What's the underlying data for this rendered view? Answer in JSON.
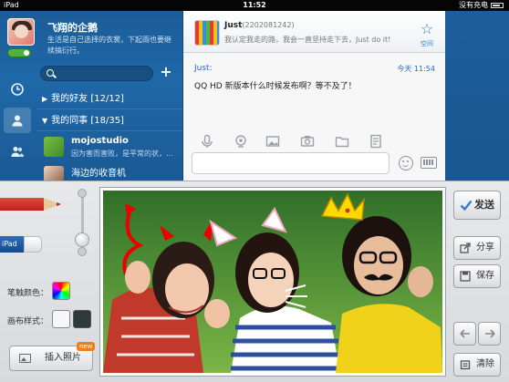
{
  "status_bar": {
    "device": "iPad",
    "time": "11:52",
    "battery_label": "没有充电"
  },
  "profile": {
    "nickname": "飞翔的企鹅",
    "signature": "生活是自己选择的衣裳，下起雨也要继续搞衍行。"
  },
  "search": {
    "placeholder": ""
  },
  "groups": [
    {
      "name": "我的好友 [12/12]"
    },
    {
      "name": "我的同事 [18/35]"
    }
  ],
  "contacts": [
    {
      "name": "mojostudio",
      "signature": "因为害而害败，是平常的状，..."
    },
    {
      "name": "海边的收音机",
      "signature": ""
    }
  ],
  "chat": {
    "friend_name": "Just",
    "friend_qq": "(2202081242)",
    "friend_signature": "我认定我走的路，我会一直坚持走下去，Just do it!",
    "space_label": "空间",
    "message": {
      "sender": "Just:",
      "time": "今天 11:54",
      "text": "QQ HD 新版本什么时候发布啊？等不及了！"
    },
    "input_placeholder": ""
  },
  "draw_panel": {
    "eraser_label": "iPad",
    "brush_color_label": "笔触颜色：",
    "canvas_style_label": "画布样式：",
    "insert_photo_label": "插入照片",
    "new_badge": "new"
  },
  "actions": {
    "send": "发送",
    "share": "分享",
    "save": "保存",
    "clear": "清除"
  },
  "colors": {
    "sidebar_blue": "#1f68a8",
    "chat_link": "#2a6bb8",
    "send_check": "#3a7fc4"
  }
}
